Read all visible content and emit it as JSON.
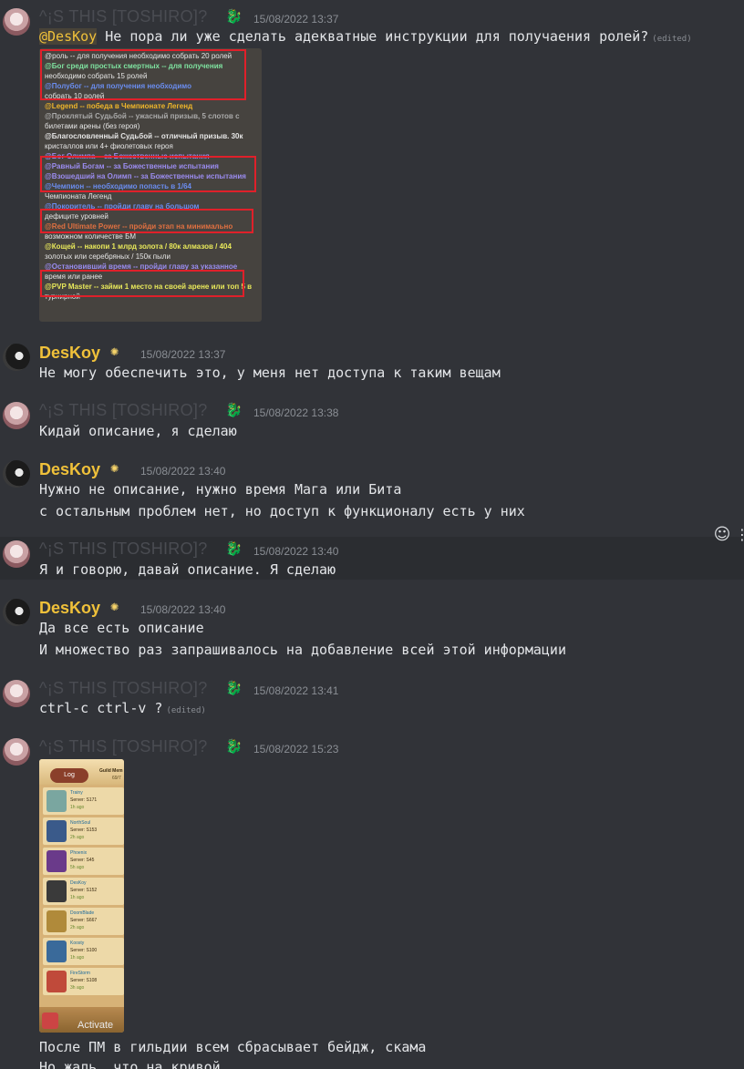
{
  "users": {
    "toshiro": {
      "name": "^¡S THIS [TOSHIRO]?",
      "badge_icon": "dragon-icon"
    },
    "deskoy": {
      "name": "DesKoy",
      "badge_icon": "sun-icon",
      "color": "#f0c13a"
    }
  },
  "messages": [
    {
      "author": "toshiro",
      "timestamp": "15/08/2022 13:37",
      "mention": "@DesKoy",
      "text": " Не пора ли уже сделать адекватные инструкции для получаения ролей?",
      "edited": "(edited)"
    },
    {
      "author": "deskoy",
      "timestamp": "15/08/2022 13:37",
      "lines": [
        "Не могу обеспечить это, у меня нет доступа к таким вещам"
      ]
    },
    {
      "author": "toshiro",
      "timestamp": "15/08/2022 13:38",
      "lines": [
        "Кидай описание, я сделаю"
      ]
    },
    {
      "author": "deskoy",
      "timestamp": "15/08/2022 13:40",
      "lines": [
        "Нужно не описание, нужно время Мага или Бита",
        "с остальным проблем нет, но доступ к функционалу есть у них"
      ]
    },
    {
      "author": "toshiro",
      "timestamp": "15/08/2022 13:40",
      "lines": [
        "Я и говорю, давай описание. Я сделаю"
      ]
    },
    {
      "author": "deskoy",
      "timestamp": "15/08/2022 13:40",
      "lines": [
        "Да все есть описание",
        "И множество раз запрашивалось на добавление всей этой информации"
      ]
    },
    {
      "author": "toshiro",
      "timestamp": "15/08/2022 13:41",
      "text": "ctrl-c ctrl-v ?",
      "edited": "(edited)"
    },
    {
      "author": "toshiro",
      "timestamp": "15/08/2022 15:23",
      "lines": [
        "После ПМ в гильдии всем сбрасывает бейдж, скама",
        "Но жаль, что на кривой"
      ]
    }
  ],
  "roles_image": {
    "rows": [
      "@роль -- для получения необходимо собрать 20 ролей",
      "@Бог среди простых смертных -- для получения",
      "необходимо собрать 15 ролей",
      "@Полубог -- для получения необходимо",
      "собрать 10 ролей",
      "@Legend -- победа в Чемпионате Легенд",
      "@Проклятый Судьбой -- ужасный призыв, 5 слотов с",
      "билетами арены (без героя)",
      "@Благословленный Судьбой -- отличный призыв. 30к",
      "кристаллов или 4+ фиолетовых героя",
      "@Бог Олимпа -- за Божественные испытания",
      "@Равный Богам -- за Божественные испытания",
      "@Взошедший на Олимп -- за Божественные испытания",
      "@Чемпион -- необходимо попасть в 1/64",
      "Чемпионата Легенд",
      "@Покоритель -- пройди главу на большом",
      "дефиците уровней",
      "@Red Ultimate Power -- пройди этап на минимально",
      "возможном количестве БМ",
      "@Кощей -- накопи 1 млрд золота / 80к алмазов / 404",
      "золотых или серебряных / 150к пыли",
      "@Остановивший время -- пройди главу за указанное",
      "время или ранее",
      "@PVP Master -- займи 1 место на своей арене или топ 5 в",
      "турнирной"
    ]
  },
  "guild_image": {
    "log_label": "Log",
    "title": "Guild Mem",
    "count": "69/7",
    "activate_label": "Activate",
    "members": [
      {
        "name": "Trainy",
        "server": "Server: S171",
        "ago": "1h ago",
        "color": "#7aa6a0"
      },
      {
        "name": "NorthSoul",
        "server": "Server: S153",
        "ago": "2h ago",
        "color": "#3a5a8a"
      },
      {
        "name": "Phoenix",
        "server": "Server: S45",
        "ago": "5h ago",
        "color": "#6a3a8a"
      },
      {
        "name": "DesKoy",
        "server": "Server: S152",
        "ago": "1h ago",
        "color": "#3a3a3a"
      },
      {
        "name": "DoomBlade",
        "server": "Server: S667",
        "ago": "2h ago",
        "color": "#b08a3a"
      },
      {
        "name": "Koosty",
        "server": "Server: S100",
        "ago": "1h ago",
        "color": "#3a6a9a"
      },
      {
        "name": "FireStorm",
        "server": "Server: S108",
        "ago": "3h ago",
        "color": "#c04a3a"
      }
    ]
  },
  "toolbar": {
    "add_reaction_icon": "add-reaction-icon"
  }
}
